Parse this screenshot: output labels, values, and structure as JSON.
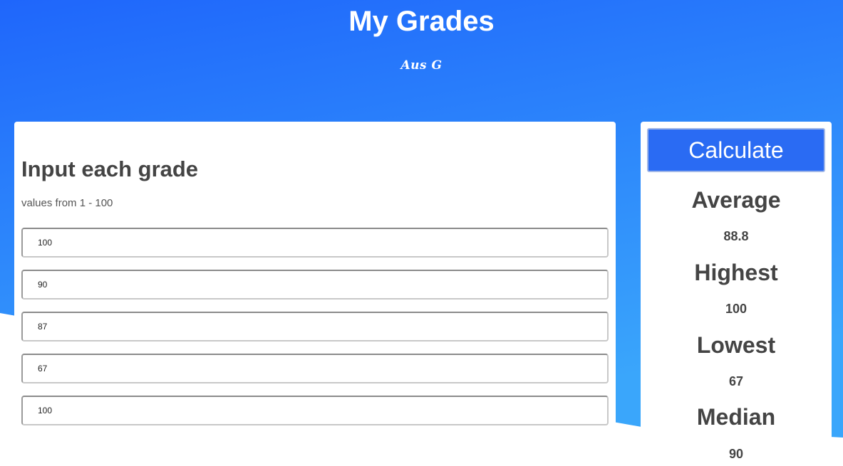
{
  "header": {
    "title": "My Grades",
    "author": "Aus G"
  },
  "colors": {
    "gradient_top": "#1f66fb",
    "gradient_bottom": "#3aa6fb",
    "button_bg": "#2a6bf3",
    "text_dark": "#444444"
  },
  "input_panel": {
    "heading": "Input each grade",
    "hint": "values from 1 - 100",
    "grades": [
      "100",
      "90",
      "87",
      "67",
      "100"
    ]
  },
  "results_panel": {
    "calculate_label": "Calculate",
    "stats": [
      {
        "label": "Average",
        "value": "88.8"
      },
      {
        "label": "Highest",
        "value": "100"
      },
      {
        "label": "Lowest",
        "value": "67"
      },
      {
        "label": "Median",
        "value": "90"
      }
    ]
  }
}
